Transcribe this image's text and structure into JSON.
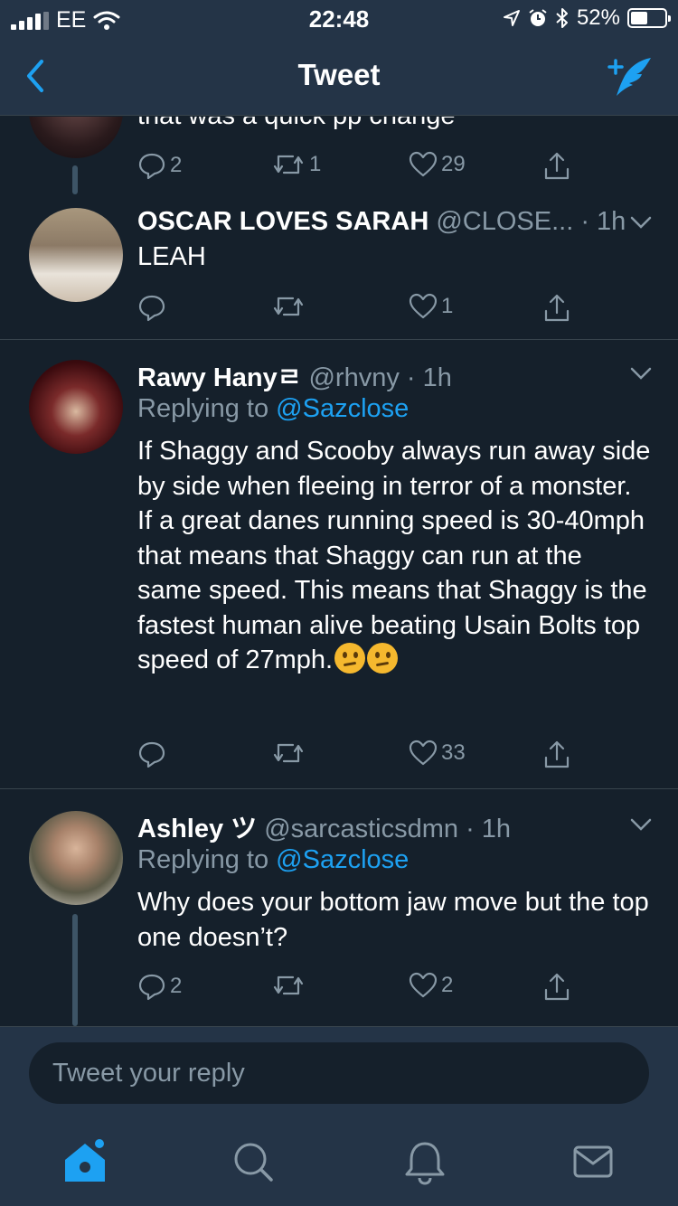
{
  "status_bar": {
    "carrier": "EE",
    "time": "22:48",
    "battery": "52%",
    "icons": [
      "signal-icon",
      "wifi-icon",
      "location-icon",
      "alarm-icon",
      "bluetooth-icon",
      "battery-icon"
    ]
  },
  "nav": {
    "title": "Tweet",
    "back_icon": "chevron-left-icon",
    "compose_icon": "compose-tweet-icon"
  },
  "tweets": [
    {
      "partial_text": "that was a quick pp change",
      "replies": "2",
      "retweets": "1",
      "likes": "29"
    },
    {
      "name": "OSCAR LOVES SARAH",
      "handle": "@CLOSE...",
      "time": "· 1h",
      "text": "LEAH",
      "replies": "",
      "retweets": "",
      "likes": "1"
    },
    {
      "name": "Rawy Hanyㄹ",
      "handle": "@rhvny",
      "time": "· 1h",
      "replying_prefix": "Replying to ",
      "replying_to": "@Sazclose",
      "text": "If Shaggy and Scooby always run away side by side when fleeing in terror of a monster. If a great danes running speed is 30-40mph that means that Shaggy can run at the same speed. This means that Shaggy is the fastest human alive beating Usain Bolts top speed of 27mph.",
      "emojis": [
        "thinking-face-emoji",
        "thinking-face-emoji"
      ],
      "replies": "",
      "retweets": "",
      "likes": "33"
    },
    {
      "name": "Ashley ツ",
      "handle": "@sarcasticsdmn",
      "time": "· 1h",
      "replying_prefix": "Replying to ",
      "replying_to": "@Sazclose",
      "text": "Why does your bottom jaw move but the top one doesn’t?",
      "replies": "2",
      "retweets": "",
      "likes": "2"
    }
  ],
  "reply_box": {
    "placeholder": "Tweet your reply"
  },
  "tab_bar": {
    "tabs": [
      "home-icon",
      "search-icon",
      "notifications-icon",
      "messages-icon"
    ],
    "active": "home-icon"
  },
  "colors": {
    "background": "#15202b",
    "bars": "#243447",
    "accent": "#1da1f2",
    "secondary_text": "#8899a6",
    "divider": "#38444d"
  }
}
